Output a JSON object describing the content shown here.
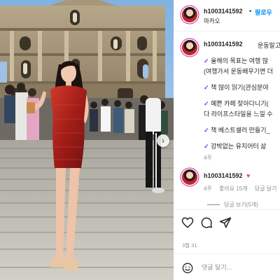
{
  "header": {
    "username": "h1003141592",
    "separator": "•",
    "follow_label": "팔로우",
    "location": "마카오"
  },
  "caption": {
    "username": "h1003141592",
    "first_line": "운동말고 목",
    "lines": [
      {
        "check": "✓",
        "text": "올해의 목표는 여행 많"
      },
      {
        "check": "",
        "text": "(여행가서 운동배우기면 더"
      },
      {
        "check": "✓",
        "text": "책 많이 읽기(관심분야"
      },
      {
        "check": "✓",
        "text": "예쁜 카페 찾아다니기("
      },
      {
        "check": "",
        "text": "다 라이프스타일을 느낄 수"
      },
      {
        "check": "✓",
        "text": "책 베스트셀러 만들기_"
      },
      {
        "check": "✓",
        "text": "강박없는 유지어터 삶"
      }
    ],
    "time": "4주"
  },
  "comment": {
    "username": "h1003141592",
    "heart": "♥",
    "time": "4주",
    "likes": "좋아요 15개",
    "reply_label": "답글 달기",
    "view_replies": "답글 보기(5개)"
  },
  "actions": {
    "icons": [
      "heart-icon",
      "comment-icon",
      "share-icon"
    ]
  },
  "date": "3월 31",
  "comment_input": {
    "placeholder": "댓글 달기..."
  },
  "colors": {
    "follow": "#0095f6",
    "check": "#5851db",
    "heart": "#ed4956",
    "muted": "#8e8e8e"
  }
}
